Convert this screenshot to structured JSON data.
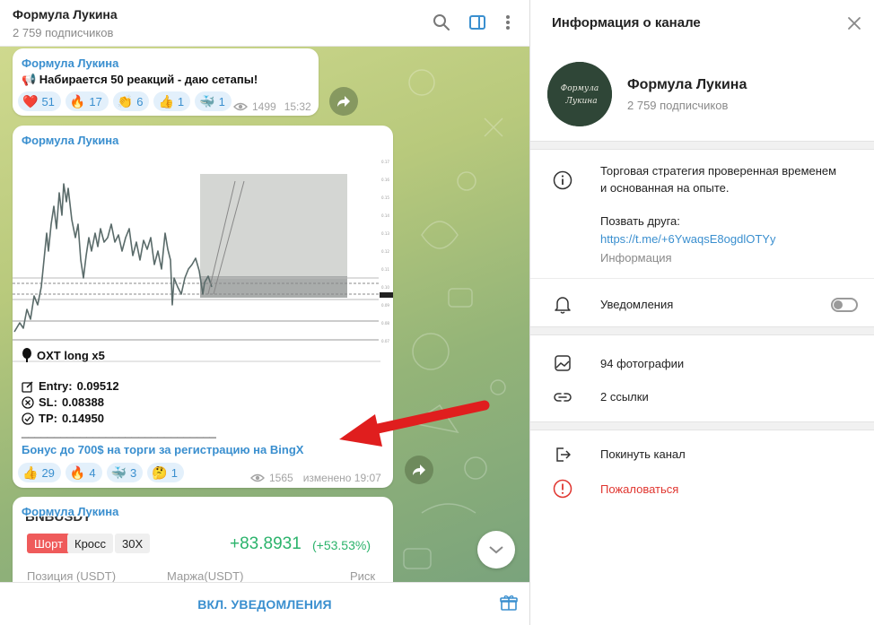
{
  "chat": {
    "title": "Формула Лукина",
    "subscribers": "2 759 подписчиков",
    "icons": [
      "search-icon",
      "sidebar-toggle-icon",
      "more-vertical-icon"
    ]
  },
  "messages": [
    {
      "author": "Формула Лукина",
      "text": "📢 Набирается 50 реакций - даю сетапы!",
      "reactions": [
        {
          "emoji": "❤️",
          "count": "51"
        },
        {
          "emoji": "🔥",
          "count": "17"
        },
        {
          "emoji": "👏",
          "count": "6"
        },
        {
          "emoji": "👍",
          "count": "1"
        },
        {
          "emoji": "🐳",
          "count": "1"
        }
      ],
      "views": "1499",
      "time": "15:32"
    },
    {
      "author": "Формула Лукина",
      "signal_title": "OXT long x5",
      "entry_label": "Entry:",
      "entry_value": "0.09512",
      "sl_label": "SL:",
      "sl_value": "0.08388",
      "tp_label": "TP:",
      "tp_value": "0.14950",
      "divider": "______________________________",
      "bonus_link": "Бонус до 700$ на торги за регистрацию на BingX",
      "reactions": [
        {
          "emoji": "👍",
          "count": "29"
        },
        {
          "emoji": "🔥",
          "count": "4"
        },
        {
          "emoji": "🐳",
          "count": "3"
        },
        {
          "emoji": "🤔",
          "count": "1"
        }
      ],
      "views": "1565",
      "edited": "изменено 19:07"
    },
    {
      "author": "Формула Лукина",
      "trade_side": "Шорт",
      "trade_mode": "Кросс",
      "leverage": "30X",
      "pnl": "+83.8931",
      "pnl_pct": "(+53.53%)",
      "col_position": "Позиция (USDT)",
      "col_margin": "Маржа(USDT)",
      "col_risk": "Риск",
      "pair_partial": "BNBUSDT"
    }
  ],
  "footer": {
    "notify_label": "ВКЛ. УВЕДОМЛЕНИЯ"
  },
  "panel": {
    "title": "Информация о канале",
    "channel_name": "Формула Лукина",
    "subscribers": "2 759 подписчиков",
    "avatar_text": "Формула Лукина",
    "description_line1": "Торговая стратегия проверенная временем",
    "description_line2": "и основанная на опыте.",
    "invite_label": "Позвать друга:",
    "invite_link": "https://t.me/+6YwaqsE8ogdlOTYy",
    "info_caption": "Информация",
    "notifications_label": "Уведомления",
    "notifications_on": false,
    "photos_label": "94 фотографии",
    "links_label": "2 ссылки",
    "leave_label": "Покинуть канал",
    "report_label": "Пожаловаться"
  },
  "colors": {
    "accent": "#3a8fcf",
    "danger": "#e0352f",
    "profit": "#2bb36b",
    "arrow": "#e01e1e"
  }
}
